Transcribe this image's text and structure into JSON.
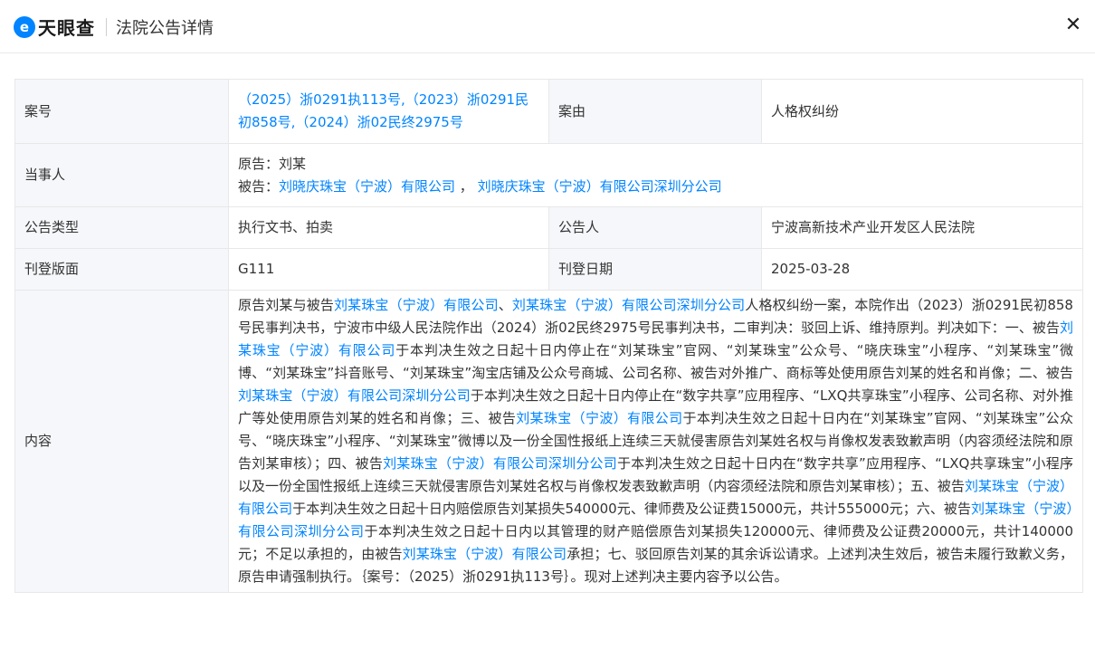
{
  "header": {
    "logo_mark": "e",
    "logo_text": "天眼查",
    "title": "法院公告详情",
    "close_glyph": "✕"
  },
  "rows": {
    "case_no": {
      "label": "案号",
      "value": "（2025）浙0291执113号,（2023）浙0291民初858号,（2024）浙02民终2975号"
    },
    "cause": {
      "label": "案由",
      "value": "人格权纠纷"
    },
    "parties": {
      "label": "当事人",
      "plaintiff_prefix": "原告：",
      "plaintiff": "刘某",
      "defendant_prefix": "被告：",
      "defendants": [
        "刘晓庆珠宝（宁波）有限公司",
        "刘晓庆珠宝（宁波）有限公司深圳分公司"
      ],
      "separator": " ， "
    },
    "type": {
      "label": "公告类型",
      "value": "执行文书、拍卖"
    },
    "announcer": {
      "label": "公告人",
      "value": "宁波高新技术产业开发区人民法院"
    },
    "page": {
      "label": "刊登版面",
      "value": "G111"
    },
    "date": {
      "label": "刊登日期",
      "value": "2025-03-28"
    },
    "content": {
      "label": "内容",
      "segments": [
        {
          "text": "原告刘某与被告",
          "link": false
        },
        {
          "text": "刘某珠宝（宁波）有限公司",
          "link": true
        },
        {
          "text": "、",
          "link": false
        },
        {
          "text": "刘某珠宝（宁波）有限公司深圳分公司",
          "link": true
        },
        {
          "text": "人格权纠纷一案，本院作出（2023）浙0291民初858号民事判决书，宁波市中级人民法院作出（2024）浙02民终2975号民事判决书，二审判决：驳回上诉、维持原判。判决如下：一、被告",
          "link": false
        },
        {
          "text": "刘某珠宝（宁波）有限公司",
          "link": true
        },
        {
          "text": "于本判决生效之日起十日内停止在“刘某珠宝”官网、“刘某珠宝”公众号、“晓庆珠宝”小程序、“刘某珠宝”微博、“刘某珠宝”抖音账号、“刘某珠宝”淘宝店铺及公众号商城、公司名称、被告对外推广、商标等处使用原告刘某的姓名和肖像；二、被告",
          "link": false
        },
        {
          "text": "刘某珠宝（宁波）有限公司深圳分公司",
          "link": true
        },
        {
          "text": "于本判决生效之日起十日内停止在“数字共享”应用程序、“LXQ共享珠宝”小程序、公司名称、对外推广等处使用原告刘某的姓名和肖像；三、被告",
          "link": false
        },
        {
          "text": "刘某珠宝（宁波）有限公司",
          "link": true
        },
        {
          "text": "于本判决生效之日起十日内在“刘某珠宝”官网、“刘某珠宝”公众号、“晓庆珠宝”小程序、“刘某珠宝”微博以及一份全国性报纸上连续三天就侵害原告刘某姓名权与肖像权发表致歉声明（内容须经法院和原告刘某审核）；四、被告",
          "link": false
        },
        {
          "text": "刘某珠宝（宁波）有限公司深圳分公司",
          "link": true
        },
        {
          "text": "于本判决生效之日起十日内在“数字共享”应用程序、“LXQ共享珠宝”小程序以及一份全国性报纸上连续三天就侵害原告刘某姓名权与肖像权发表致歉声明（内容须经法院和原告刘某审核）；五、被告",
          "link": false
        },
        {
          "text": "刘某珠宝（宁波）有限公司",
          "link": true
        },
        {
          "text": "于本判决生效之日起十日内赔偿原告刘某损失540000元、律师费及公证费15000元，共计555000元；六、被告",
          "link": false
        },
        {
          "text": "刘某珠宝（宁波）有限公司深圳分公司",
          "link": true
        },
        {
          "text": "于本判决生效之日起十日内以其管理的财产赔偿原告刘某损失120000元、律师费及公证费20000元，共计140000元；不足以承担的，由被告",
          "link": false
        },
        {
          "text": "刘某珠宝（宁波）有限公司",
          "link": true
        },
        {
          "text": "承担；七、驳回原告刘某的其余诉讼请求。上述判决生效后，被告未履行致歉义务，原告申请强制执行。｛案号：（2025）浙0291执113号｝。现对上述判决主要内容予以公告。",
          "link": false
        }
      ]
    }
  },
  "colors": {
    "link": "#0084ff",
    "label_bg": "#f5f7fa",
    "border": "#e8e8e8",
    "brand": "#0084ff"
  }
}
